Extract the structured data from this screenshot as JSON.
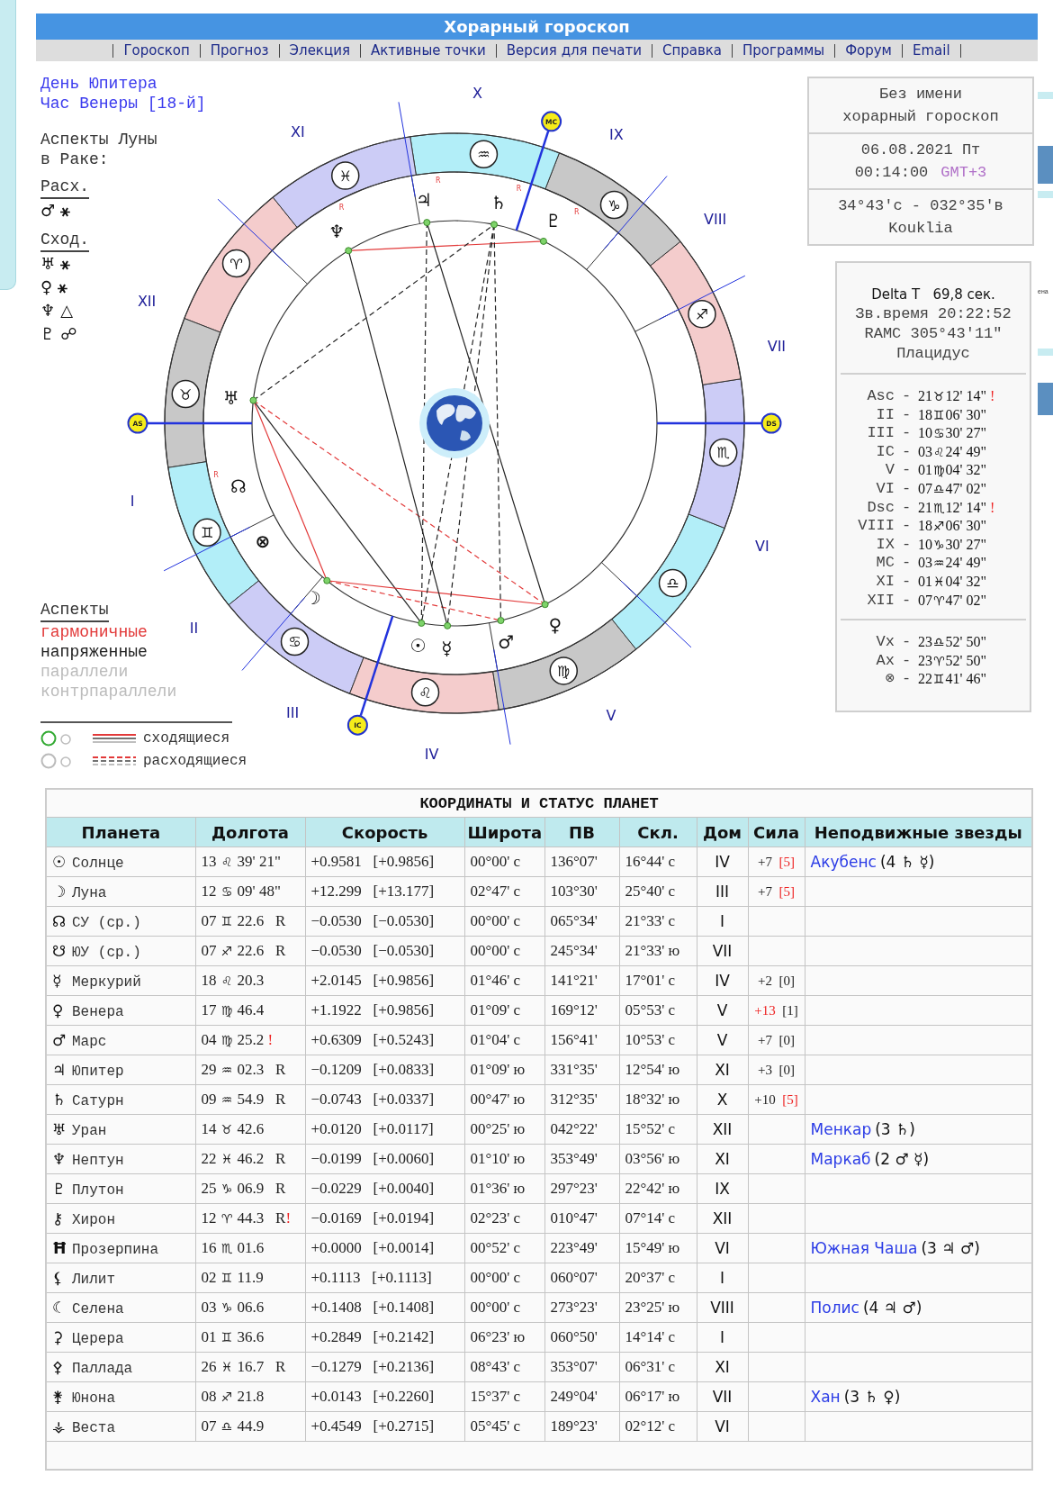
{
  "header": {
    "title": "Хорарный гороскоп"
  },
  "nav": [
    "Гороскоп",
    "Прогноз",
    "Элекция",
    "Активные точки",
    "Версия для печати",
    "Справка",
    "Программы",
    "Форум",
    "Email"
  ],
  "left": {
    "day": "День Юпитера",
    "hour": "Час Венеры [18-й]",
    "moon_title": "Аспекты Луны в Раке:",
    "separating": {
      "label": "Расх.",
      "items": [
        {
          "planet": "♂",
          "aspect": "⚹"
        }
      ]
    },
    "applying": {
      "label": "Сход.",
      "items": [
        {
          "planet": "♅",
          "aspect": "⚹"
        },
        {
          "planet": "♀",
          "aspect": "⚹"
        },
        {
          "planet": "♆",
          "aspect": "△"
        },
        {
          "planet": "♇",
          "aspect": "☍"
        }
      ]
    },
    "legend_title": "Аспекты",
    "legend": [
      {
        "kind": "harmonious",
        "label": "гармоничные"
      },
      {
        "kind": "tense",
        "label": "напряженные"
      },
      {
        "kind": "parallel",
        "label": "параллели"
      },
      {
        "kind": "contraparallel",
        "label": "контрпараллели"
      }
    ],
    "motion": [
      {
        "kind": "applying",
        "label": "сходящиеся"
      },
      {
        "kind": "separating",
        "label": "расходящиеся"
      }
    ]
  },
  "wheel": {
    "signs": [
      {
        "glyph": "♈",
        "color": "#f4cccc"
      },
      {
        "glyph": "♉",
        "color": "#c8c8c8"
      },
      {
        "glyph": "♊",
        "color": "#b2eef8"
      },
      {
        "glyph": "♋",
        "color": "#ccccf6"
      },
      {
        "glyph": "♌",
        "color": "#f4cccc"
      },
      {
        "glyph": "♍",
        "color": "#c8c8c8"
      },
      {
        "glyph": "♎",
        "color": "#b2eef8"
      },
      {
        "glyph": "♏",
        "color": "#ccccf6"
      },
      {
        "glyph": "♐",
        "color": "#f4cccc"
      },
      {
        "glyph": "♑",
        "color": "#c8c8c8"
      },
      {
        "glyph": "♒",
        "color": "#b2eef8"
      },
      {
        "glyph": "♓",
        "color": "#ccccf6"
      }
    ],
    "houses": [
      "I",
      "II",
      "III",
      "IV",
      "V",
      "VI",
      "VII",
      "VIII",
      "IX",
      "X",
      "XI",
      "XII"
    ],
    "angles": [
      "AS",
      "IC",
      "DS",
      "MC"
    ],
    "planets": [
      {
        "glyph": "♆",
        "retro": "R"
      },
      {
        "glyph": "♃",
        "retro": "R"
      },
      {
        "glyph": "♄",
        "retro": "R"
      },
      {
        "glyph": "♇",
        "retro": "R"
      },
      {
        "glyph": "♅"
      },
      {
        "glyph": "☊",
        "retro": "R"
      },
      {
        "glyph": "⊗"
      },
      {
        "glyph": "☽"
      },
      {
        "glyph": "♀"
      },
      {
        "glyph": "☉"
      },
      {
        "glyph": "☿"
      },
      {
        "glyph": "♂"
      }
    ]
  },
  "info": {
    "name": [
      "Без имени",
      "хорарный гороскоп"
    ],
    "date": "06.08.2021 Пт",
    "time": "00:14:00",
    "timezone": "GMT+3",
    "coords": "34°43'с - 032°35'в",
    "place": "Kouklia"
  },
  "houses_panel": {
    "delta": "Delta T   69,8 сек.",
    "sidereal": "Зв.время 20:22:52",
    "ramc": "RAMC 305°43'11\"",
    "system": "Плацидус",
    "sep": "-",
    "cusps": [
      {
        "name": "Asc",
        "deg": "21",
        "sign": "♉",
        "rest": "12' 14\"",
        "flag": "!"
      },
      {
        "name": "II",
        "deg": "18",
        "sign": "♊",
        "rest": "06' 30\""
      },
      {
        "name": "III",
        "deg": "10",
        "sign": "♋",
        "rest": "30' 27\""
      },
      {
        "name": "IC",
        "deg": "03",
        "sign": "♌",
        "rest": "24' 49\""
      },
      {
        "name": "V",
        "deg": "01",
        "sign": "♍",
        "rest": "04' 32\""
      },
      {
        "name": "VI",
        "deg": "07",
        "sign": "♎",
        "rest": "47' 02\""
      },
      {
        "name": "Dsc",
        "deg": "21",
        "sign": "♏",
        "rest": "12' 14\"",
        "flag": "!"
      },
      {
        "name": "VIII",
        "deg": "18",
        "sign": "♐",
        "rest": "06' 30\""
      },
      {
        "name": "IX",
        "deg": "10",
        "sign": "♑",
        "rest": "30' 27\""
      },
      {
        "name": "MC",
        "deg": "03",
        "sign": "♒",
        "rest": "24' 49\""
      },
      {
        "name": "XI",
        "deg": "01",
        "sign": "♓",
        "rest": "04' 32\""
      },
      {
        "name": "XII",
        "deg": "07",
        "sign": "♈",
        "rest": "47' 02\""
      }
    ],
    "points": [
      {
        "name": "Vx",
        "deg": "23",
        "sign": "♎",
        "rest": "52' 50\""
      },
      {
        "name": "Ax",
        "deg": "23",
        "sign": "♈",
        "rest": "52' 50\""
      },
      {
        "name": "⊗",
        "deg": "22",
        "sign": "♊",
        "rest": "41' 46\""
      }
    ]
  },
  "table": {
    "title": "КООРДИНАТЫ И СТАТУС ПЛАНЕТ",
    "columns": [
      "Планета",
      "Долгота",
      "Скорость",
      "Широта",
      "ПВ",
      "Скл.",
      "Дом",
      "Сила",
      "Неподвижные звезды"
    ],
    "rows": [
      {
        "glyph": "☉",
        "name": "Солнце",
        "lon": {
          "deg": "13",
          "sign": "♌",
          "rest": "39' 21\""
        },
        "speed": "+0.9581",
        "mean": "[+0.9856]",
        "lat": "00°00' с",
        "ra": "136°07'",
        "decl": "16°44' с",
        "house": "IV",
        "strength": {
          "value": "+7",
          "value_red": false,
          "rank": "[5]",
          "rank_red": true
        },
        "star": {
          "name": "Акубенс",
          "note": "(4 ♄ ☿)"
        }
      },
      {
        "glyph": "☽",
        "name": "Луна",
        "lon": {
          "deg": "12",
          "sign": "♋",
          "rest": "09' 48\""
        },
        "speed": "+12.299",
        "mean": "[+13.177]",
        "lat": "02°47' с",
        "ra": "103°30'",
        "decl": "25°40' с",
        "house": "III",
        "strength": {
          "value": "+7",
          "value_red": false,
          "rank": "[5]",
          "rank_red": true
        }
      },
      {
        "glyph": "☊",
        "name": "СУ (ср.)",
        "lon": {
          "deg": "07",
          "sign": "♊",
          "rest": "22.6",
          "retro": "R"
        },
        "speed": "−0.0530",
        "mean": "[−0.0530]",
        "lat": "00°00' с",
        "ra": "065°34'",
        "decl": "21°33' с",
        "house": "I"
      },
      {
        "glyph": "☋",
        "name": "ЮУ (ср.)",
        "lon": {
          "deg": "07",
          "sign": "♐",
          "rest": "22.6",
          "retro": "R"
        },
        "speed": "−0.0530",
        "mean": "[−0.0530]",
        "lat": "00°00' с",
        "ra": "245°34'",
        "decl": "21°33' ю",
        "house": "VII"
      },
      {
        "glyph": "☿",
        "name": "Меркурий",
        "lon": {
          "deg": "18",
          "sign": "♌",
          "rest": "20.3"
        },
        "speed": "+2.0145",
        "mean": "[+0.9856]",
        "lat": "01°46' с",
        "ra": "141°21'",
        "decl": "17°01' с",
        "house": "IV",
        "strength": {
          "value": "+2",
          "value_red": false,
          "rank": "[0]",
          "rank_red": false
        }
      },
      {
        "glyph": "♀",
        "name": "Венера",
        "lon": {
          "deg": "17",
          "sign": "♍",
          "rest": "46.4"
        },
        "speed": "+1.1922",
        "mean": "[+0.9856]",
        "lat": "01°09' с",
        "ra": "169°12'",
        "decl": "05°53' с",
        "house": "V",
        "strength": {
          "value": "+13",
          "value_red": true,
          "rank": "[1]",
          "rank_red": false
        }
      },
      {
        "glyph": "♂",
        "name": "Марс",
        "lon": {
          "deg": "04",
          "sign": "♍",
          "rest": "25.2",
          "flag": "!"
        },
        "speed": "+0.6309",
        "mean": "[+0.5243]",
        "lat": "01°04' с",
        "ra": "156°41'",
        "decl": "10°53' с",
        "house": "V",
        "strength": {
          "value": "+7",
          "value_red": false,
          "rank": "[0]",
          "rank_red": false
        }
      },
      {
        "glyph": "♃",
        "name": "Юпитер",
        "lon": {
          "deg": "29",
          "sign": "♒",
          "rest": "02.3",
          "retro": "R"
        },
        "speed": "−0.1209",
        "mean": "[+0.0833]",
        "lat": "01°09' ю",
        "ra": "331°35'",
        "decl": "12°54' ю",
        "house": "XI",
        "strength": {
          "value": "+3",
          "value_red": false,
          "rank": "[0]",
          "rank_red": false
        }
      },
      {
        "glyph": "♄",
        "name": "Сатурн",
        "lon": {
          "deg": "09",
          "sign": "♒",
          "rest": "54.9",
          "retro": "R"
        },
        "speed": "−0.0743",
        "mean": "[+0.0337]",
        "lat": "00°47' ю",
        "ra": "312°35'",
        "decl": "18°32' ю",
        "house": "X",
        "strength": {
          "value": "+10",
          "value_red": false,
          "rank": "[5]",
          "rank_red": true
        }
      },
      {
        "glyph": "♅",
        "name": "Уран",
        "lon": {
          "deg": "14",
          "sign": "♉",
          "rest": "42.6"
        },
        "speed": "+0.0120",
        "mean": "[+0.0117]",
        "lat": "00°25' ю",
        "ra": "042°22'",
        "decl": "15°52' с",
        "house": "XII",
        "star": {
          "name": "Менкар",
          "note": "(3 ♄)"
        }
      },
      {
        "glyph": "♆",
        "name": "Нептун",
        "lon": {
          "deg": "22",
          "sign": "♓",
          "rest": "46.2",
          "retro": "R"
        },
        "speed": "−0.0199",
        "mean": "[+0.0060]",
        "lat": "01°10' ю",
        "ra": "353°49'",
        "decl": "03°56' ю",
        "house": "XI",
        "star": {
          "name": "Маркаб",
          "note": "(2 ♂ ☿)"
        }
      },
      {
        "glyph": "♇",
        "name": "Плутон",
        "lon": {
          "deg": "25",
          "sign": "♑",
          "rest": "06.9",
          "retro": "R"
        },
        "speed": "−0.0229",
        "mean": "[+0.0040]",
        "lat": "01°36' ю",
        "ra": "297°23'",
        "decl": "22°42' ю",
        "house": "IX"
      },
      {
        "glyph": "⚷",
        "name": "Хирон",
        "lon": {
          "deg": "12",
          "sign": "♈",
          "rest": "44.3",
          "retro": "R",
          "flag": "!"
        },
        "speed": "−0.0169",
        "mean": "[+0.0194]",
        "lat": "02°23' с",
        "ra": "010°47'",
        "decl": "07°14' с",
        "house": "XII"
      },
      {
        "glyph": "Ħ",
        "name": "Прозерпина",
        "lon": {
          "deg": "16",
          "sign": "♏",
          "rest": "01.6"
        },
        "speed": "+0.0000",
        "mean": "[+0.0014]",
        "lat": "00°52' с",
        "ra": "223°49'",
        "decl": "15°49' ю",
        "house": "VI",
        "star": {
          "name": "Южная Чаша",
          "note": "(3 ♃ ♂)"
        }
      },
      {
        "glyph": "⚸",
        "name": "Лилит",
        "lon": {
          "deg": "02",
          "sign": "♊",
          "rest": "11.9"
        },
        "speed": "+0.1113",
        "mean": "[+0.1113]",
        "lat": "00°00' с",
        "ra": "060°07'",
        "decl": "20°37' с",
        "house": "I"
      },
      {
        "glyph": "☾",
        "name": "Селена",
        "lon": {
          "deg": "03",
          "sign": "♑",
          "rest": "06.6"
        },
        "speed": "+0.1408",
        "mean": "[+0.1408]",
        "lat": "00°00' с",
        "ra": "273°23'",
        "decl": "23°25' ю",
        "house": "VIII",
        "star": {
          "name": "Полис",
          "note": "(4 ♃ ♂)"
        }
      },
      {
        "glyph": "⚳",
        "name": "Церера",
        "lon": {
          "deg": "01",
          "sign": "♊",
          "rest": "36.6"
        },
        "speed": "+0.2849",
        "mean": "[+0.2142]",
        "lat": "06°23' ю",
        "ra": "060°50'",
        "decl": "14°14' с",
        "house": "I"
      },
      {
        "glyph": "⚴",
        "name": "Паллада",
        "lon": {
          "deg": "26",
          "sign": "♓",
          "rest": "16.7",
          "retro": "R"
        },
        "speed": "−0.1279",
        "mean": "[+0.2136]",
        "lat": "08°43' с",
        "ra": "353°07'",
        "decl": "06°31' с",
        "house": "XI"
      },
      {
        "glyph": "⚵",
        "name": "Юнона",
        "lon": {
          "deg": "08",
          "sign": "♐",
          "rest": "21.8"
        },
        "speed": "+0.0143",
        "mean": "[+0.2260]",
        "lat": "15°37' с",
        "ra": "249°04'",
        "decl": "06°17' ю",
        "house": "VII",
        "star": {
          "name": "Хан",
          "note": "(3 ♄ ♀)"
        }
      },
      {
        "glyph": "⚶",
        "name": "Веста",
        "lon": {
          "deg": "07",
          "sign": "♎",
          "rest": "44.9"
        },
        "speed": "+0.4549",
        "mean": "[+0.2715]",
        "lat": "05°45' с",
        "ra": "189°23'",
        "decl": "02°12' с",
        "house": "VI"
      }
    ]
  },
  "right_edge": {
    "text": "ена"
  }
}
